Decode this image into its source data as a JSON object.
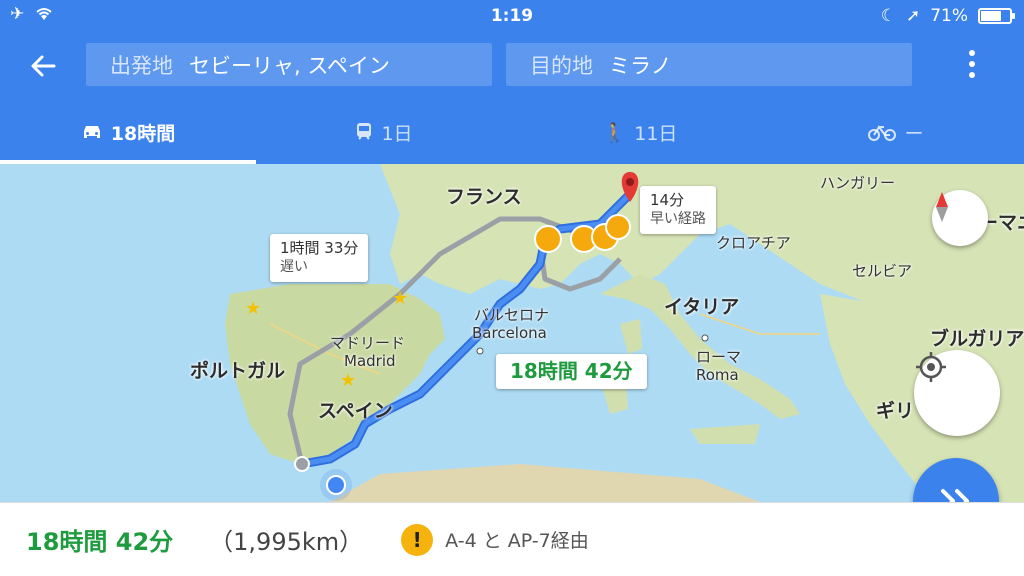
{
  "status": {
    "time": "1:19",
    "battery": "71%",
    "battery_level": 0.71
  },
  "search": {
    "origin_label": "出発地",
    "origin_value": "セビーリャ, スペイン",
    "dest_label": "目的地",
    "dest_value": "ミラノ"
  },
  "tabs": [
    {
      "icon": "car-icon",
      "label": "18時間",
      "active": true
    },
    {
      "icon": "train-icon",
      "label": "1日",
      "active": false
    },
    {
      "icon": "walk-icon",
      "label": "11日",
      "active": false
    },
    {
      "icon": "bike-icon",
      "label": "ー",
      "active": false
    }
  ],
  "map": {
    "countries": [
      "フランス",
      "ハンガリー",
      "ルーマニア",
      "クロアチア",
      "セルビア",
      "イタリア",
      "ブルガリア",
      "ポルトガル",
      "スペイン",
      "ギリ"
    ],
    "cities": {
      "barcelona_jp": "バルセロナ",
      "barcelona": "Barcelona",
      "madrid_jp": "マドリード",
      "madrid": "Madrid",
      "roma_jp": "ローマ",
      "roma": "Roma"
    },
    "callouts": {
      "alt1_time": "1時間 33分",
      "alt1_note": "遅い",
      "alt2_time": "14分",
      "alt2_note": "早い経路",
      "main_time": "18時間 42分"
    }
  },
  "summary": {
    "duration": "18時間 42分",
    "distance": "（1,995km）",
    "warning": "!",
    "via": "A-4 と AP-7経由"
  },
  "colors": {
    "header": "#3b82ec",
    "route_main": "#3b82ec",
    "route_alt": "#9aa0a6",
    "duration_green": "#1e9b3e"
  }
}
